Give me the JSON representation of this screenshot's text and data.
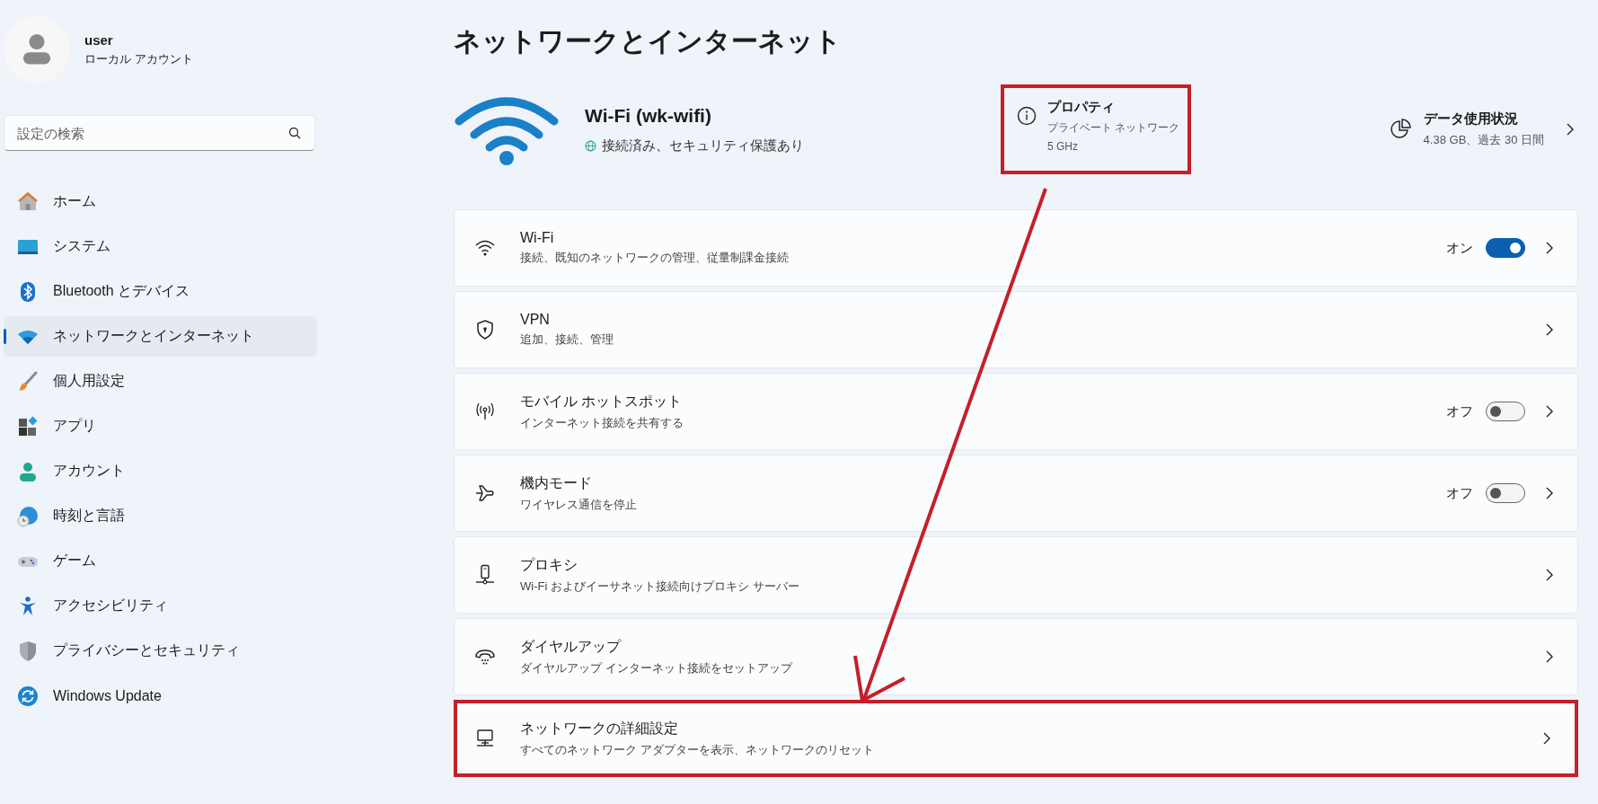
{
  "account": {
    "name": "user",
    "type": "ローカル アカウント"
  },
  "search": {
    "placeholder": "設定の検索"
  },
  "sidebar": {
    "items": [
      {
        "label": "ホーム",
        "kind": "home",
        "selected": false
      },
      {
        "label": "システム",
        "kind": "system",
        "selected": false
      },
      {
        "label": "Bluetooth とデバイス",
        "kind": "bluetooth",
        "selected": false
      },
      {
        "label": "ネットワークとインターネット",
        "kind": "network",
        "selected": true
      },
      {
        "label": "個人用設定",
        "kind": "brush",
        "selected": false
      },
      {
        "label": "アプリ",
        "kind": "apps",
        "selected": false
      },
      {
        "label": "アカウント",
        "kind": "account",
        "selected": false
      },
      {
        "label": "時刻と言語",
        "kind": "time",
        "selected": false
      },
      {
        "label": "ゲーム",
        "kind": "game",
        "selected": false
      },
      {
        "label": "アクセシビリティ",
        "kind": "accessibility",
        "selected": false
      },
      {
        "label": "プライバシーとセキュリティ",
        "kind": "privacy",
        "selected": false
      },
      {
        "label": "Windows Update",
        "kind": "update",
        "selected": false
      }
    ]
  },
  "page_title": "ネットワークとインターネット",
  "connection": {
    "name": "Wi-Fi (wk-wifi)",
    "status": "接続済み、セキュリティ保護あり"
  },
  "properties": {
    "title": "プロパティ",
    "lines": [
      "プライベート ネットワーク",
      "5 GHz"
    ],
    "highlighted": true
  },
  "data_usage": {
    "title": "データ使用状況",
    "detail": "4.38 GB、過去 30 日間"
  },
  "rows": [
    {
      "kind": "wifi",
      "title": "Wi-Fi",
      "subtitle": "接続、既知のネットワークの管理、従量制課金接続",
      "toggle": {
        "label": "オン",
        "on": true
      },
      "highlighted": false
    },
    {
      "kind": "vpn",
      "title": "VPN",
      "subtitle": "追加、接続、管理",
      "highlighted": false
    },
    {
      "kind": "hotspot",
      "title": "モバイル ホットスポット",
      "subtitle": "インターネット接続を共有する",
      "toggle": {
        "label": "オフ",
        "on": false
      },
      "highlighted": false
    },
    {
      "kind": "airplane",
      "title": "機内モード",
      "subtitle": "ワイヤレス通信を停止",
      "toggle": {
        "label": "オフ",
        "on": false
      },
      "highlighted": false
    },
    {
      "kind": "proxy",
      "title": "プロキシ",
      "subtitle": "Wi-Fi およびイーサネット接続向けプロキシ サーバー",
      "highlighted": false
    },
    {
      "kind": "dialup",
      "title": "ダイヤルアップ",
      "subtitle": "ダイヤルアップ インターネット接続をセットアップ",
      "highlighted": false
    },
    {
      "kind": "advanced",
      "title": "ネットワークの詳細設定",
      "subtitle": "すべてのネットワーク アダプターを表示、ネットワークのリセット",
      "highlighted": true
    }
  ]
}
